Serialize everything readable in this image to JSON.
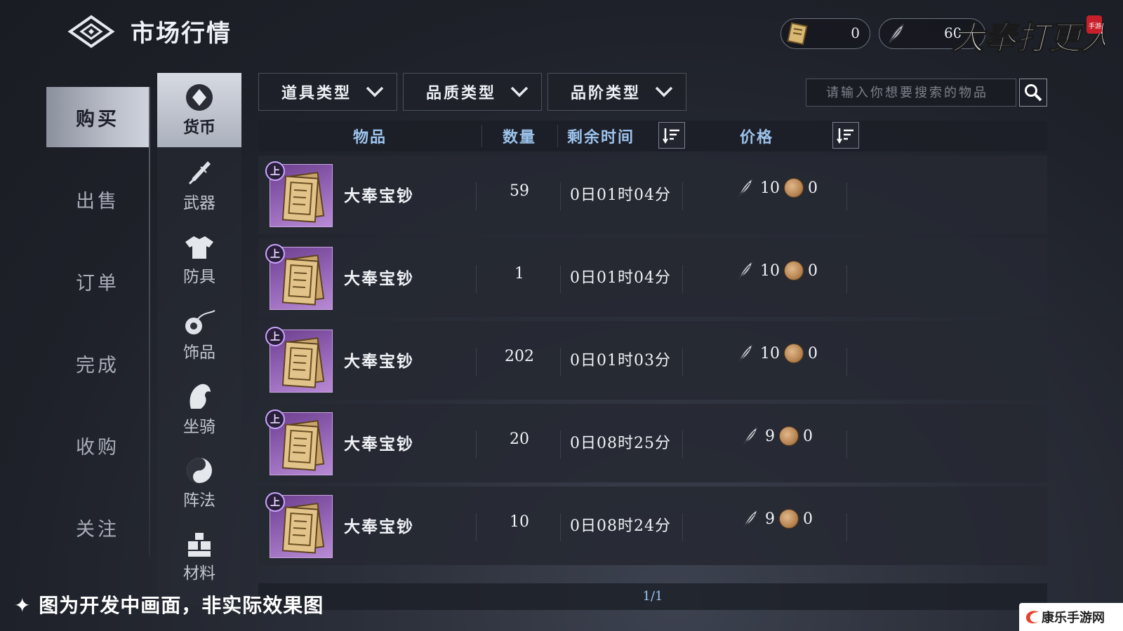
{
  "header": {
    "title": "市场行情",
    "currency_1_value": "0",
    "currency_2_value": "60",
    "logo_text": "大奉打更人",
    "logo_badge": "手游"
  },
  "left_tabs": [
    {
      "label": "购买",
      "active": true
    },
    {
      "label": "出售",
      "active": false
    },
    {
      "label": "订单",
      "active": false
    },
    {
      "label": "完成",
      "active": false
    },
    {
      "label": "收购",
      "active": false
    },
    {
      "label": "关注",
      "active": false
    }
  ],
  "categories": [
    {
      "label": "货币",
      "icon": "diamond-icon",
      "active": true
    },
    {
      "label": "武器",
      "icon": "sword-icon",
      "active": false
    },
    {
      "label": "防具",
      "icon": "armor-icon",
      "active": false
    },
    {
      "label": "饰品",
      "icon": "accessory-icon",
      "active": false
    },
    {
      "label": "坐骑",
      "icon": "horse-icon",
      "active": false
    },
    {
      "label": "阵法",
      "icon": "formation-icon",
      "active": false
    },
    {
      "label": "材料",
      "icon": "material-icon",
      "active": false
    }
  ],
  "filters": [
    {
      "label": "道具类型"
    },
    {
      "label": "品质类型"
    },
    {
      "label": "品阶类型"
    }
  ],
  "search": {
    "placeholder": "请输入你想要搜索的物品"
  },
  "table": {
    "headers": {
      "item": "物品",
      "quantity": "数量",
      "remaining": "剩余时间",
      "price": "价格"
    },
    "rows": [
      {
        "badge": "上",
        "name": "大奉宝钞",
        "quantity": "59",
        "time": "0日01时04分",
        "price_a": "10",
        "price_b": "0"
      },
      {
        "badge": "上",
        "name": "大奉宝钞",
        "quantity": "1",
        "time": "0日01时04分",
        "price_a": "10",
        "price_b": "0"
      },
      {
        "badge": "上",
        "name": "大奉宝钞",
        "quantity": "202",
        "time": "0日01时03分",
        "price_a": "10",
        "price_b": "0"
      },
      {
        "badge": "上",
        "name": "大奉宝钞",
        "quantity": "20",
        "time": "0日08时25分",
        "price_a": "9",
        "price_b": "0"
      },
      {
        "badge": "上",
        "name": "大奉宝钞",
        "quantity": "10",
        "time": "0日08时24分",
        "price_a": "9",
        "price_b": "0"
      }
    ]
  },
  "pager": "1/1",
  "notice": "✦ 图为开发中画面，非实际效果图",
  "watermark": "康乐手游网"
}
